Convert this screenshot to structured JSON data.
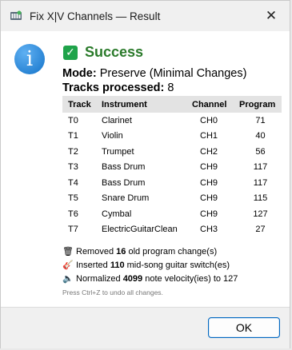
{
  "window": {
    "title": "Fix X|V Channels — Result",
    "close_glyph": "✕"
  },
  "status": {
    "icon": "info-icon",
    "icon_glyph": "i",
    "check_glyph": "✓",
    "heading": "Success",
    "heading_color": "#2a7a2a"
  },
  "summary": {
    "mode_label": "Mode:",
    "mode_value": "Preserve (Minimal Changes)",
    "tracks_label": "Tracks processed:",
    "tracks_value": "8"
  },
  "table": {
    "headers": [
      "Track",
      "Instrument",
      "Channel",
      "Program"
    ],
    "rows": [
      [
        "T0",
        "Clarinet",
        "CH0",
        "71"
      ],
      [
        "T1",
        "Violin",
        "CH1",
        "40"
      ],
      [
        "T2",
        "Trumpet",
        "CH2",
        "56"
      ],
      [
        "T3",
        "Bass Drum",
        "CH9",
        "117"
      ],
      [
        "T4",
        "Bass Drum",
        "CH9",
        "117"
      ],
      [
        "T5",
        "Snare Drum",
        "CH9",
        "115"
      ],
      [
        "T6",
        "Cymbal",
        "CH9",
        "127"
      ],
      [
        "T7",
        "ElectricGuitarClean",
        "CH3",
        "27"
      ]
    ]
  },
  "notes": [
    {
      "icon": "trash-icon",
      "glyph": "🗑",
      "prefix": "Removed ",
      "count": "16",
      "suffix": " old program change(s)"
    },
    {
      "icon": "guitar-icon",
      "glyph": "🎸",
      "prefix": "Inserted ",
      "count": "110",
      "suffix": " mid-song guitar switch(es)"
    },
    {
      "icon": "speaker-icon",
      "glyph": "🔈",
      "prefix": "Normalized ",
      "count": "4099",
      "suffix": " note velocity(ies) to 127"
    }
  ],
  "hint": "Press Ctrl+Z to undo all changes.",
  "footer": {
    "ok_label": "OK"
  }
}
